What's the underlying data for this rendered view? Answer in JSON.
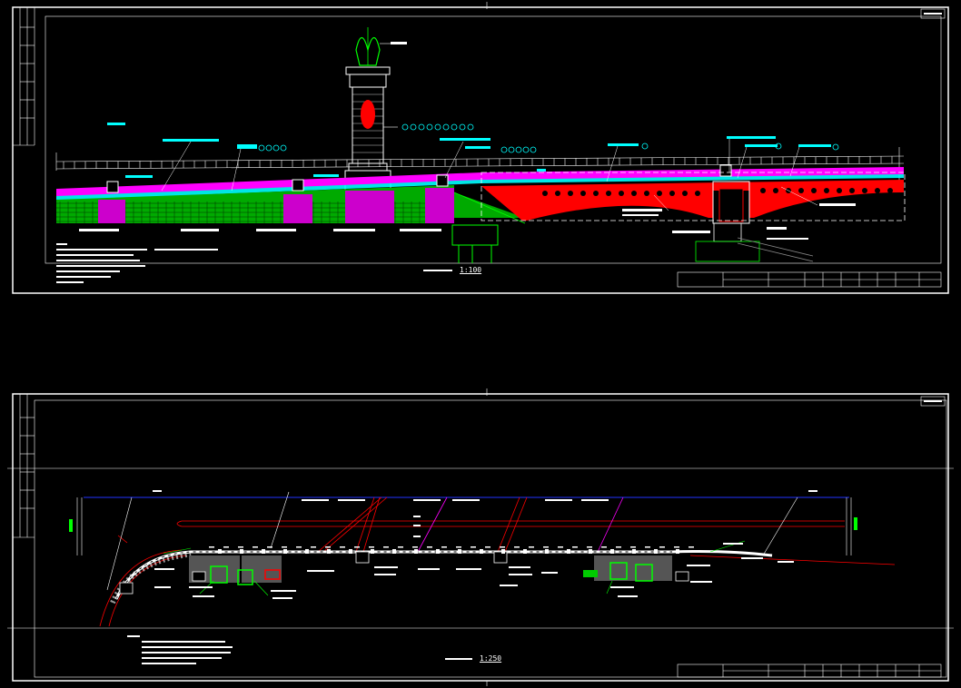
{
  "drawing": {
    "elevation_sheet": {
      "scale_caption": "1:100"
    },
    "plan_sheet": {
      "scale_caption": "1:250"
    }
  },
  "colors": {
    "background": "#000000",
    "frame": "#ffffff",
    "masonry": "#00cc00",
    "paving": "#ff00ff",
    "steel_arch": "#ff0000",
    "water_line": "#00ffff",
    "leader_tag": "#00ffff",
    "baseline": "#0000ff"
  }
}
